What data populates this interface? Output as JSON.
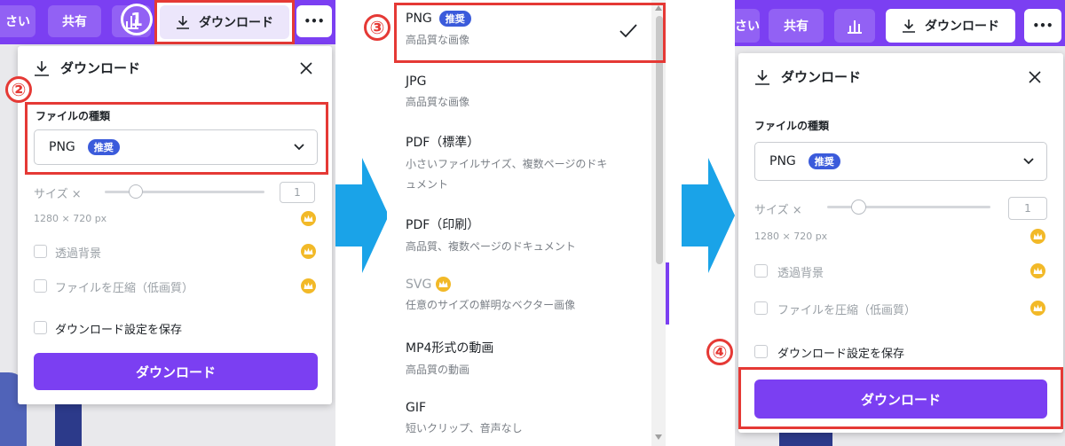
{
  "panel1": {
    "toolbar": {
      "left_partial": "さい",
      "share": "共有",
      "download": "ダウンロード",
      "more": "•••"
    },
    "header": {
      "title": "ダウンロード"
    },
    "file_type_label": "ファイルの種類",
    "select_value": "PNG",
    "badge": "推奨",
    "size_label": "サイズ ×",
    "size_value": "1",
    "dimensions": "1280 × 720 px",
    "transparent": "透過背景",
    "compress": "ファイルを圧縮（低画質）",
    "save_settings": "ダウンロード設定を保存",
    "button": "ダウンロード",
    "step2": "②"
  },
  "panel2": {
    "step3": "③",
    "items": [
      {
        "title": "PNG",
        "badge": "推奨",
        "desc": "高品質な画像",
        "selected": true
      },
      {
        "title": "JPG",
        "desc": "高品質な画像"
      },
      {
        "title": "PDF（標準）",
        "desc": "小さいファイルサイズ、複数ページのドキ",
        "desc2": "ュメント"
      },
      {
        "title": "PDF（印刷）",
        "desc": "高品質、複数ページのドキュメント"
      },
      {
        "title": "SVG",
        "desc": "任意のサイズの鮮明なベクター画像",
        "premium": true
      },
      {
        "title": "MP4形式の動画",
        "desc": "高品質の動画"
      },
      {
        "title": "GIF",
        "desc": "短いクリップ、音声なし"
      }
    ]
  },
  "panel3": {
    "toolbar": {
      "left_partial": "さい",
      "share": "共有",
      "download": "ダウンロード",
      "more": "•••"
    },
    "header": {
      "title": "ダウンロード"
    },
    "file_type_label": "ファイルの種類",
    "select_value": "PNG",
    "badge": "推奨",
    "size_label": "サイズ ×",
    "size_value": "1",
    "dimensions": "1280 × 720 px",
    "transparent": "透過背景",
    "compress": "ファイルを圧縮（低画質）",
    "save_settings": "ダウンロード設定を保存",
    "button": "ダウンロード",
    "step4": "④"
  },
  "colors": {
    "accent": "#7b3ff2",
    "badge": "#3b5bdb",
    "annotation": "#e53935",
    "arrow": "#1aa3e8",
    "crown": "#f2b928"
  }
}
